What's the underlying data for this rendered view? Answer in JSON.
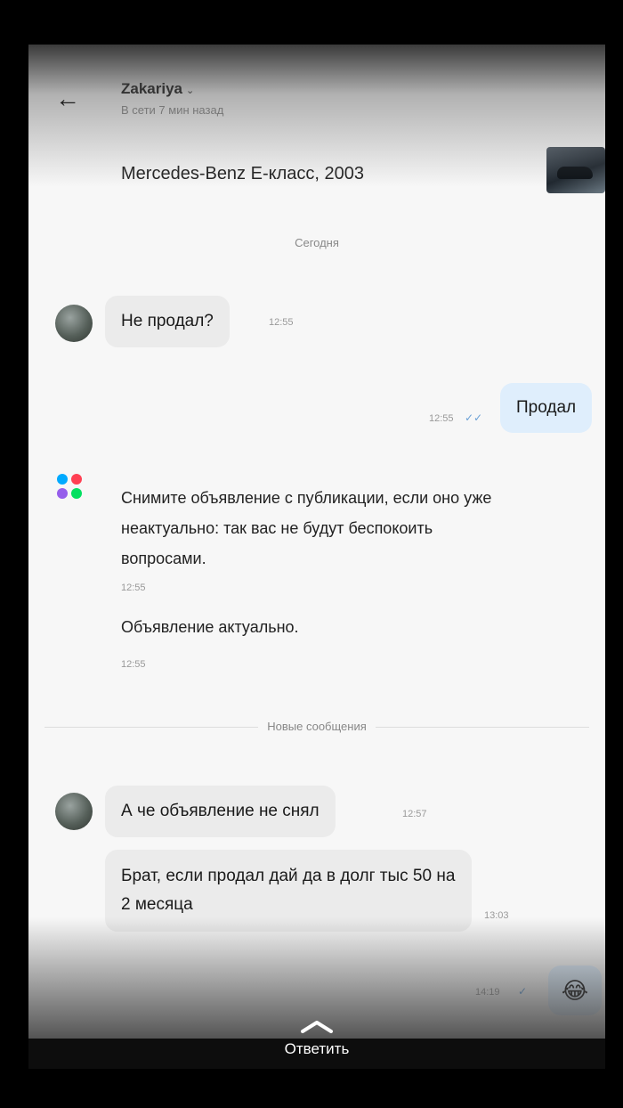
{
  "header": {
    "contact_name": "Zakariya",
    "contact_chevron": "⌄",
    "contact_status": "В сети 7 мин назад",
    "back_icon": "arrow-left-icon"
  },
  "listing": {
    "title": "Mercedes-Benz E-класс, 2003",
    "thumbnail_icon": "car-photo-thumbnail"
  },
  "separators": {
    "date": "Сегодня",
    "new_messages": "Новые сообщения"
  },
  "messages": [
    {
      "side": "in",
      "text": "Не продал?",
      "time": "12:55"
    },
    {
      "side": "out",
      "text": "Продал",
      "time": "12:55",
      "status": "✓✓"
    },
    {
      "side": "in",
      "text": "А че объявление не снял",
      "time": "12:57"
    },
    {
      "side": "in",
      "text": "Брат, если продал дай да в долг тыс 50 на 2 месяца",
      "time": "13:03"
    },
    {
      "side": "out",
      "text": "😂",
      "time": "14:19",
      "status": "✓"
    }
  ],
  "system": {
    "text": "Снимите объявление с публикации, если оно уже неактуально: так вас не будут беспокоить вопросами.",
    "time": "12:55",
    "reply_text": "Объявление актуально.",
    "reply_time": "12:55",
    "logo_colors": [
      "#00aaff",
      "#ff4053",
      "#965eeb",
      "#04e061"
    ]
  },
  "footer": {
    "reply_label": "Ответить"
  }
}
